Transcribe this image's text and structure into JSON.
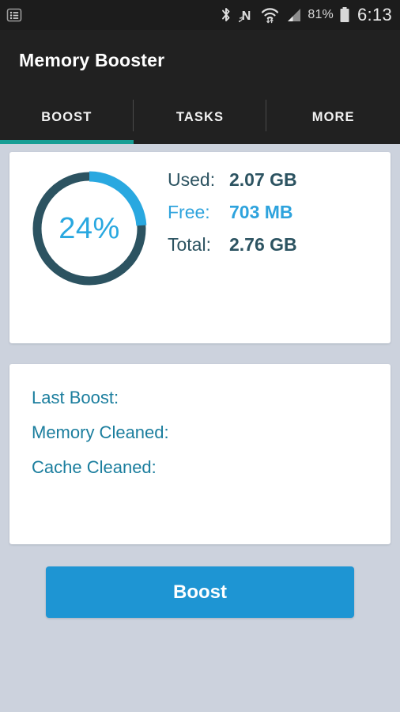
{
  "statusbar": {
    "left_icons": [
      {
        "name": "notification-list-icon",
        "glyph": "list-card"
      }
    ],
    "right_icons": [
      {
        "name": "bluetooth-icon",
        "glyph": "bluetooth"
      },
      {
        "name": "nfc-icon",
        "glyph": "nfc"
      },
      {
        "name": "wifi-icon",
        "glyph": "wifi"
      },
      {
        "name": "cellular-signal-icon",
        "glyph": "signal"
      }
    ],
    "battery_percent": "81%",
    "battery_icon": "battery-icon",
    "time": "6:13"
  },
  "actionbar": {
    "title": "Memory Booster"
  },
  "tabs": [
    {
      "label": "BOOST",
      "active": true
    },
    {
      "label": "TASKS",
      "active": false
    },
    {
      "label": "MORE",
      "active": false
    }
  ],
  "memory_card": {
    "gauge": {
      "name": "memory-usage-gauge",
      "percent_text": "24%",
      "percent_value": 24,
      "track_color": "#2c5361",
      "arc_color": "#29a8e0"
    },
    "stats": [
      {
        "key": "Used:",
        "value": "2.07 GB",
        "highlight": false
      },
      {
        "key": "Free:",
        "value": "703 MB",
        "highlight": true
      },
      {
        "key": "Total:",
        "value": "2.76 GB",
        "highlight": false
      }
    ]
  },
  "history_card": {
    "rows": [
      {
        "key": "Last Boost:",
        "value": ""
      },
      {
        "key": "Memory Cleaned:",
        "value": ""
      },
      {
        "key": "Cache Cleaned:",
        "value": ""
      }
    ]
  },
  "boost_button": {
    "label": "Boost"
  },
  "colors": {
    "page_background": "#ccd2dd",
    "status_bar": "#1c1c1c",
    "action_bar": "#212121",
    "tab_indicator": "#179e95",
    "accent_blue": "#1e95d3",
    "accent_light_blue": "#2ea3dd",
    "dark_teal": "#2c5361",
    "card": "#ffffff"
  }
}
